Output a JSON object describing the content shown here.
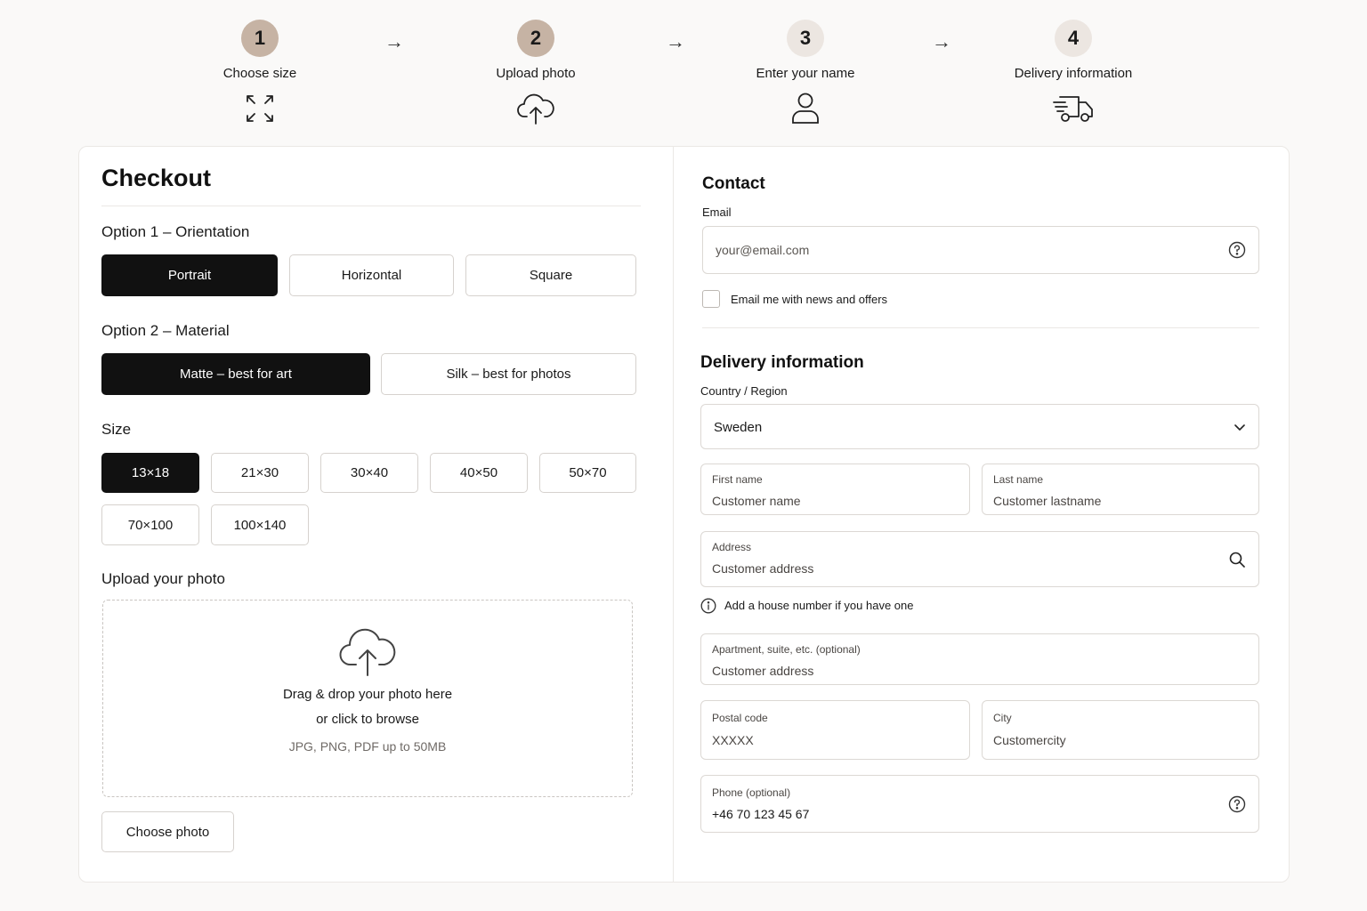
{
  "steps": [
    {
      "number": "1",
      "label": "Choose size",
      "icon": "resize-arrows-icon",
      "state": "done"
    },
    {
      "number": "2",
      "label": "Upload photo",
      "icon": "cloud-upload-icon",
      "state": "done"
    },
    {
      "number": "3",
      "label": "Enter your name",
      "icon": "user-icon",
      "state": "todo"
    },
    {
      "number": "4",
      "label": "Delivery information",
      "icon": "delivery-truck-icon",
      "state": "todo"
    }
  ],
  "step_arrow": "→",
  "checkout": {
    "title": "Checkout",
    "orientation": {
      "title": "Option 1 – Orientation",
      "options": [
        "Portrait",
        "Horizontal",
        "Square"
      ],
      "selected": "Portrait"
    },
    "material": {
      "title": "Option 2 – Material",
      "options": [
        "Matte – best for art",
        "Silk – best for photos"
      ],
      "selected": "Matte – best for art"
    },
    "size": {
      "title": "Size",
      "options": [
        "13×18",
        "21×30",
        "30×40",
        "40×50",
        "50×70",
        "70×100",
        "100×140"
      ],
      "selected": "13×18"
    },
    "upload": {
      "title": "Upload your photo",
      "line1": "Drag & drop your photo here",
      "line2": "or click to browse",
      "hint": "JPG, PNG, PDF up to 50MB",
      "button": "Choose photo"
    }
  },
  "contact": {
    "title": "Contact",
    "email_label": "Email",
    "email_placeholder": "your@email.com",
    "newsletter_label": "Email me with news and offers"
  },
  "delivery": {
    "title": "Delivery information",
    "country_label": "Country / Region",
    "country_value": "Sweden",
    "first_name_label": "First name",
    "first_name_value": "Customer name",
    "last_name_label": "Last name",
    "last_name_value": "Customer lastname",
    "address_label": "Address",
    "address_value": "Customer address",
    "address_hint": "Add a house number if you have one",
    "apartment_label": "Apartment, suite, etc. (optional)",
    "apartment_value": "Customer address",
    "postal_label": "Postal code",
    "postal_value": "XXXXX",
    "city_label": "City",
    "city_value": "Customercity",
    "phone_label": "Phone (optional)",
    "phone_value": "+46 70 123 45 67"
  },
  "colors": {
    "step_done": "#c6b3a4",
    "step_todo": "#ece6e1",
    "selected_chip": "#111111",
    "border": "#d6d2ce"
  }
}
